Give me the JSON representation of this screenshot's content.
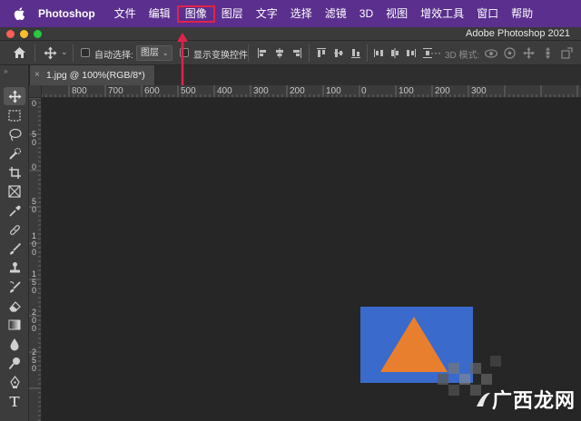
{
  "menubar": {
    "apple_icon": "apple-icon",
    "app_name": "Photoshop",
    "items": [
      {
        "label": "文件",
        "highlighted": false
      },
      {
        "label": "编辑",
        "highlighted": false
      },
      {
        "label": "图像",
        "highlighted": true
      },
      {
        "label": "图层",
        "highlighted": false
      },
      {
        "label": "文字",
        "highlighted": false
      },
      {
        "label": "选择",
        "highlighted": false
      },
      {
        "label": "滤镜",
        "highlighted": false
      },
      {
        "label": "3D",
        "highlighted": false
      },
      {
        "label": "视图",
        "highlighted": false
      },
      {
        "label": "增效工具",
        "highlighted": false
      },
      {
        "label": "窗口",
        "highlighted": false
      },
      {
        "label": "帮助",
        "highlighted": false
      }
    ],
    "highlight_color": "#e0234b",
    "background": "#5a2f8e"
  },
  "window": {
    "title": "Adobe Photoshop 2021",
    "traffic_lights": [
      "#ff5f57",
      "#febc2e",
      "#28c840"
    ]
  },
  "options_bar": {
    "home_icon": "home-icon",
    "move_icon": "move-tool-icon",
    "auto_select_label": "自动选择:",
    "auto_select_checked": false,
    "target_value": "图层",
    "transform_controls_label": "显示变换控件",
    "transform_controls_checked": false,
    "mode_3d_label": "3D 模式:",
    "align_icons": [
      "align-left-icon",
      "align-center-h-icon",
      "align-right-icon",
      "align-top-icon",
      "align-middle-v-icon",
      "align-bottom-icon",
      "more-icon"
    ],
    "icons_3d": [
      "orbit-3d-icon",
      "roll-3d-icon",
      "drag-3d-icon",
      "slide-3d-icon",
      "scale-3d-icon"
    ]
  },
  "document": {
    "tab_label": "1.jpg @ 100%(RGB/8*)",
    "close_glyph": "×"
  },
  "rulers": {
    "horizontal_labels": [
      "800",
      "700",
      "600",
      "500",
      "400",
      "300",
      "200",
      "100",
      "0",
      "100",
      "200",
      "300"
    ],
    "vertical_labels": [
      "0",
      "50",
      "0",
      "50",
      "100",
      "150",
      "200",
      "250"
    ]
  },
  "canvas": {
    "artwork": {
      "rect_color": "#3a6acb",
      "triangle_color": "#e87f2e"
    }
  },
  "toolbar": {
    "tools": [
      "move-tool-icon",
      "marquee-tool-icon",
      "lasso-tool-icon",
      "quick-select-tool-icon",
      "crop-tool-icon",
      "frame-tool-icon",
      "eyedropper-tool-icon",
      "healing-brush-tool-icon",
      "brush-tool-icon",
      "clone-stamp-tool-icon",
      "history-brush-tool-icon",
      "eraser-tool-icon",
      "gradient-tool-icon",
      "blur-tool-icon",
      "dodge-tool-icon",
      "pen-tool-icon",
      "type-tool-icon"
    ]
  },
  "watermark": {
    "text": "广西龙网"
  }
}
